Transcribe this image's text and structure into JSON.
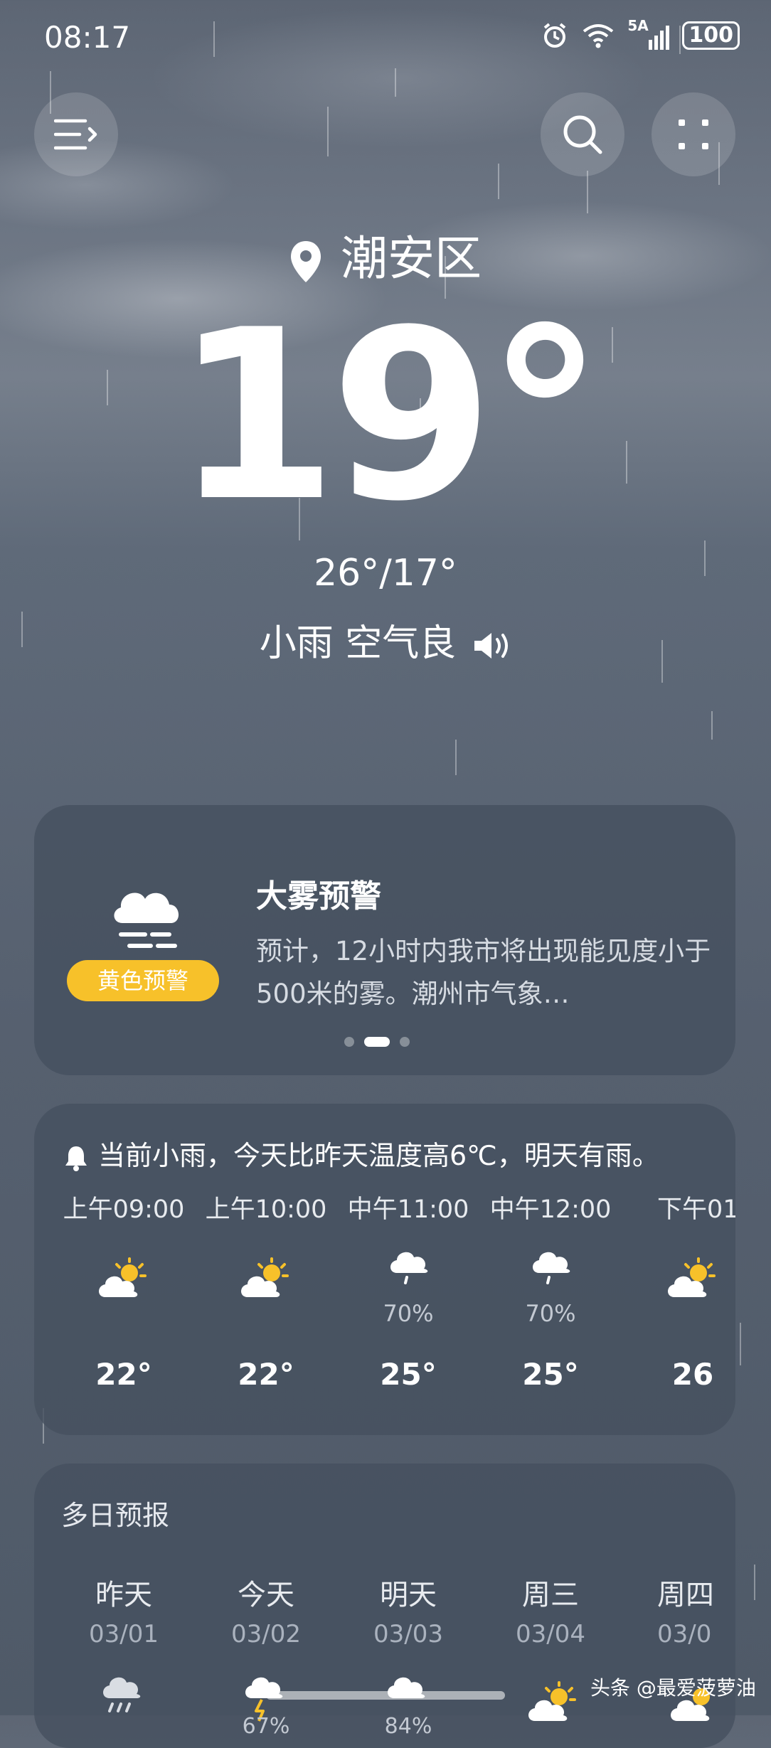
{
  "status_bar": {
    "time": "08:17",
    "network": "5A",
    "battery": "100"
  },
  "location": "潮安区",
  "current_temp": "19°",
  "temp_range": "26°/17°",
  "condition": "小雨 空气良",
  "alert": {
    "title": "大雾预警",
    "level": "黄色预警",
    "level_color": "#f7c12a",
    "text": "预计，12小时内我市将出现能见度小于500米的雾。潮州市气象…"
  },
  "hourly": {
    "summary": "当前小雨，今天比昨天温度高6℃，明天有雨。",
    "items": [
      {
        "time": "上午09:00",
        "icon": "partly-sunny-icon",
        "precip": "",
        "temp": "22°"
      },
      {
        "time": "上午10:00",
        "icon": "partly-sunny-icon",
        "precip": "",
        "temp": "22°"
      },
      {
        "time": "中午11:00",
        "icon": "light-rain-icon",
        "precip": "70%",
        "temp": "25°"
      },
      {
        "time": "中午12:00",
        "icon": "light-rain-icon",
        "precip": "70%",
        "temp": "25°"
      },
      {
        "time": "下午01",
        "icon": "partly-sunny-icon",
        "precip": "",
        "temp": "26"
      }
    ]
  },
  "daily": {
    "title": "多日预报",
    "items": [
      {
        "day": "昨天",
        "date": "03/01",
        "icon": "rain-icon"
      },
      {
        "day": "今天",
        "date": "03/02",
        "icon": "thunder-rain-icon"
      },
      {
        "day": "明天",
        "date": "03/03",
        "icon": "cloudy-icon"
      },
      {
        "day": "周三",
        "date": "03/04",
        "icon": "partly-sunny-icon"
      },
      {
        "day": "周四",
        "date": "03/0",
        "icon": "partly-sunny-icon"
      }
    ],
    "partial_precip": [
      "67%",
      "84%"
    ]
  },
  "watermark": "头条 @最爱菠萝油"
}
